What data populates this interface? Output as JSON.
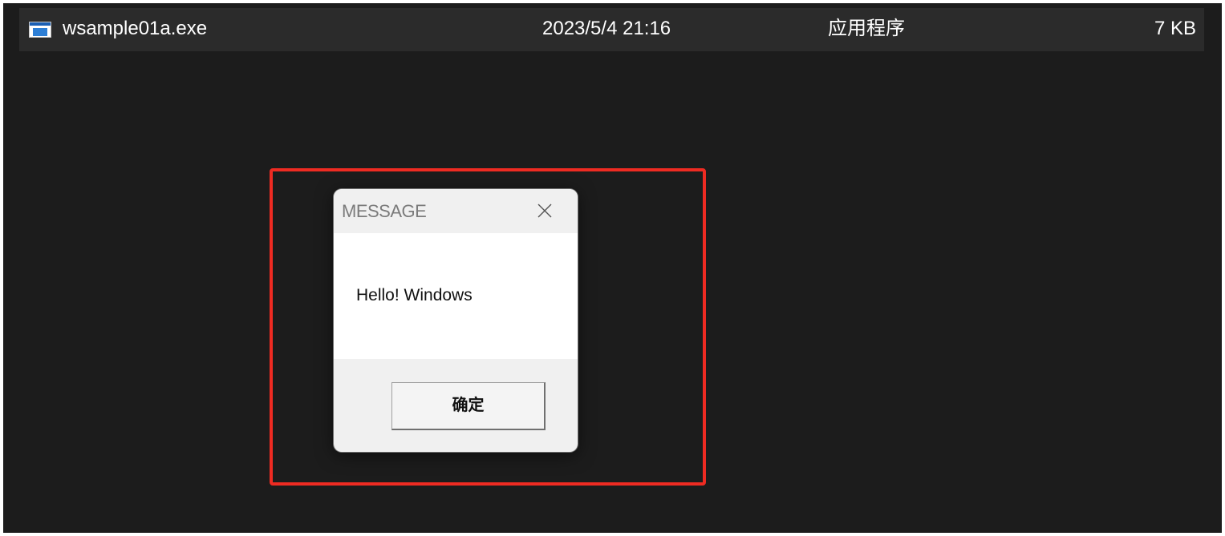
{
  "file_row": {
    "icon": "application-window-icon",
    "name": "wsample01a.exe",
    "date": "2023/5/4 21:16",
    "type": "应用程序",
    "size": "7 KB"
  },
  "dialog": {
    "title": "MESSAGE",
    "message": "Hello! Windows",
    "ok_label": "确定",
    "close_icon": "close-icon"
  },
  "colors": {
    "background": "#1c1c1c",
    "file_row": "#2b2b2b",
    "highlight": "#ee2b22",
    "dialog_bg": "#f0f0f0"
  }
}
